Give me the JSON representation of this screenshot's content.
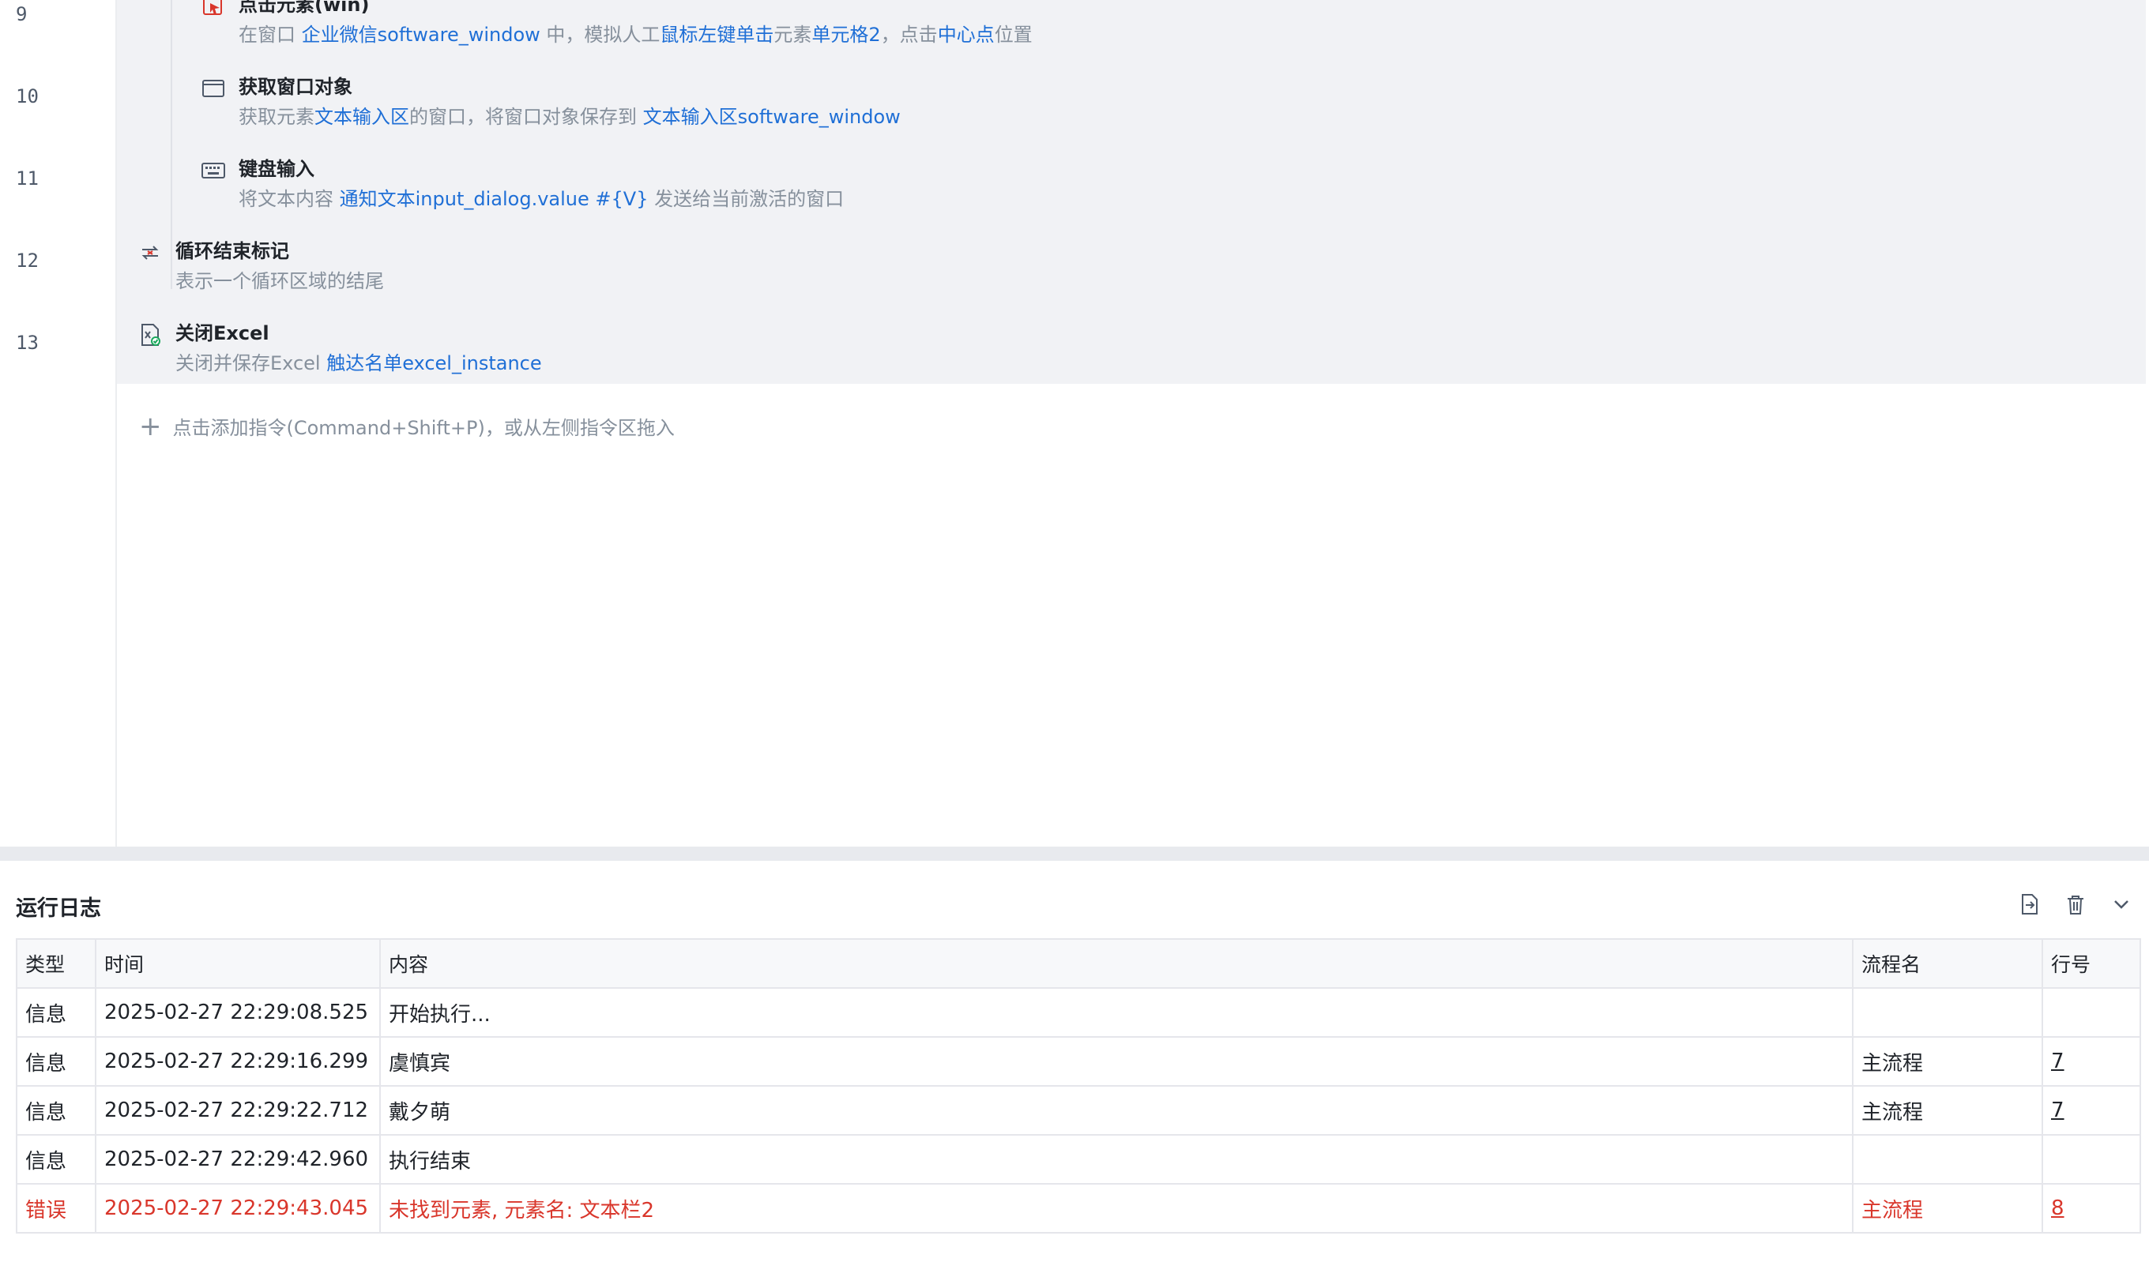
{
  "editor": {
    "line_numbers": [
      "9",
      "10",
      "11",
      "12",
      "13"
    ],
    "steps": [
      {
        "title": "点击元素(win)",
        "icon": "click-element-icon",
        "desc": [
          {
            "t": "在窗口 ",
            "link": false
          },
          {
            "t": "企业微信software_window",
            "link": true
          },
          {
            "t": " 中，模拟人工",
            "link": false
          },
          {
            "t": "鼠标左键单击",
            "link": true
          },
          {
            "t": "元素",
            "link": false
          },
          {
            "t": "单元格2",
            "link": true
          },
          {
            "t": "，点击",
            "link": false
          },
          {
            "t": "中心点",
            "link": true
          },
          {
            "t": "位置",
            "link": false
          }
        ]
      },
      {
        "title": "获取窗口对象",
        "icon": "window-icon",
        "desc": [
          {
            "t": "获取元素",
            "link": false
          },
          {
            "t": "文本输入区",
            "link": true
          },
          {
            "t": "的窗口，将窗口对象保存到 ",
            "link": false
          },
          {
            "t": "文本输入区software_window",
            "link": true
          }
        ]
      },
      {
        "title": "键盘输入",
        "icon": "keyboard-icon",
        "desc": [
          {
            "t": "将文本内容 ",
            "link": false
          },
          {
            "t": "通知文本input_dialog.value",
            "link": true
          },
          {
            "t": " ",
            "link": false
          },
          {
            "t": "#{V}",
            "link": true
          },
          {
            "t": " 发送给当前激活的窗口",
            "link": false
          }
        ]
      },
      {
        "title": "循环结束标记",
        "icon": "loop-end-icon",
        "desc": [
          {
            "t": "表示一个循环区域的结尾",
            "link": false
          }
        ]
      },
      {
        "title": "关闭Excel",
        "icon": "excel-close-icon",
        "desc": [
          {
            "t": "关闭并保存Excel ",
            "link": false
          },
          {
            "t": "触达名单excel_instance",
            "link": true
          }
        ]
      }
    ],
    "add_command_label": "点击添加指令(Command+Shift+P)，或从左侧指令区拖入"
  },
  "log": {
    "title": "运行日志",
    "actions": [
      "export-icon",
      "trash-icon",
      "chevron-down-icon"
    ],
    "columns": [
      "类型",
      "时间",
      "内容",
      "流程名",
      "行号"
    ],
    "rows": [
      {
        "type": "信息",
        "time": "2025-02-27 22:29:08.525",
        "content": "开始执行...",
        "flow": "",
        "line": "",
        "level": "info"
      },
      {
        "type": "信息",
        "time": "2025-02-27 22:29:16.299",
        "content": "虞慎宾",
        "flow": "主流程",
        "line": "7",
        "level": "info"
      },
      {
        "type": "信息",
        "time": "2025-02-27 22:29:22.712",
        "content": "戴夕萌",
        "flow": "主流程",
        "line": "7",
        "level": "info"
      },
      {
        "type": "信息",
        "time": "2025-02-27 22:29:42.960",
        "content": "执行结束",
        "flow": "",
        "line": "",
        "level": "info"
      },
      {
        "type": "错误",
        "time": "2025-02-27 22:29:43.045",
        "content": "未找到元素, 元素名: 文本栏2",
        "flow": "主流程",
        "line": "8",
        "level": "error"
      }
    ]
  },
  "colors": {
    "link": "#1f6fd6",
    "error": "#d9362b",
    "step_bg": "#f1f2f5"
  }
}
